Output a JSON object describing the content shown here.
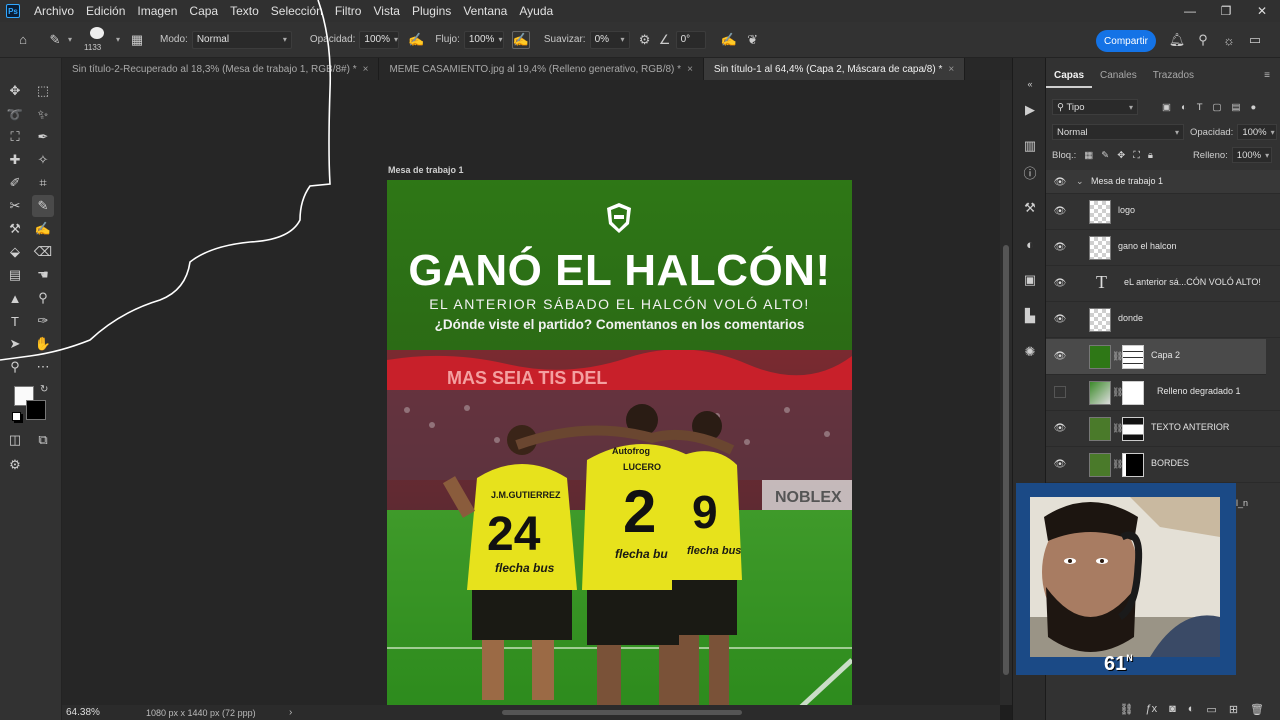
{
  "app": {
    "logo_text": "Ps",
    "menu": [
      "Archivo",
      "Edición",
      "Imagen",
      "Capa",
      "Texto",
      "Selección",
      "Filtro",
      "Vista",
      "Plugins",
      "Ventana",
      "Ayuda"
    ]
  },
  "options": {
    "brush_size": "1133",
    "mode_label": "Modo:",
    "mode_value": "Normal",
    "opacity_label": "Opacidad:",
    "opacity_value": "100%",
    "flow_label": "Flujo:",
    "flow_value": "100%",
    "smoothing_label": "Suavizar:",
    "smoothing_value": "0%",
    "angle_value": "0°",
    "share_label": "Compartir"
  },
  "tabs": [
    {
      "label": "Sin título-2-Recuperado al 18,3% (Mesa de trabajo 1, RGB/8#) *",
      "active": false
    },
    {
      "label": "MEME CASAMIENTO.jpg al 19,4% (Relleno generativo, RGB/8) *",
      "active": false
    },
    {
      "label": "Sin título-1 al 64,4% (Capa 2, Máscara de capa/8) *",
      "active": true
    }
  ],
  "artboard": {
    "label": "Mesa de trabajo 1",
    "headline": "GANÓ EL HALCÓN!",
    "subline": "EL ANTERIOR SÁBADO EL HALCÓN VOLÓ ALTO!",
    "question": "¿Dónde viste el partido? Comentanos en los comentarios",
    "banner_text": "MAS   SEIA   TIS        DEL",
    "sponsor": "NOBLEX",
    "players": [
      {
        "number": "24",
        "name": "J.M.GUTIERREZ",
        "sponsor": "flecha bus"
      },
      {
        "number": "2",
        "name": "LUCERO",
        "sponsor": "flecha bus"
      },
      {
        "number": "9",
        "name": "",
        "sponsor": "flecha bus"
      }
    ],
    "jersey_brand": "Autofrog"
  },
  "status": {
    "zoom": "64.38%",
    "doc_size": "1080 px x 1440 px (72 ppp)",
    "arrow": "›"
  },
  "layers_panel": {
    "tabs": [
      "Capas",
      "Canales",
      "Trazados"
    ],
    "filter_label": "Tipo",
    "blend_mode": "Normal",
    "opacity_label": "Opacidad:",
    "opacity_value": "100%",
    "lock_label": "Bloq.:",
    "fill_label": "Relleno:",
    "fill_value": "100%",
    "group_name": "Mesa de trabajo 1",
    "layers": [
      {
        "name": "logo",
        "kind": "pixel"
      },
      {
        "name": "gano el halcon",
        "kind": "pixel"
      },
      {
        "name": "eL anterior sá...CÓN VOLÓ ALTO!",
        "kind": "text"
      },
      {
        "name": "donde",
        "kind": "pixel"
      },
      {
        "name": "Capa 2",
        "kind": "masked",
        "selected": true
      },
      {
        "name": "Relleno degradado 1",
        "kind": "masked",
        "hidden": true
      },
      {
        "name": "TEXTO ANTERIOR",
        "kind": "masked"
      },
      {
        "name": "BORDES",
        "kind": "masked"
      }
    ],
    "partial_label": "l_n"
  },
  "webcam": {
    "badge": "61",
    "badge_sup": "N"
  },
  "colors": {
    "accent": "#1473e6",
    "artboard_green": "#2b6d14",
    "jersey_yellow": "#e7e21c"
  }
}
